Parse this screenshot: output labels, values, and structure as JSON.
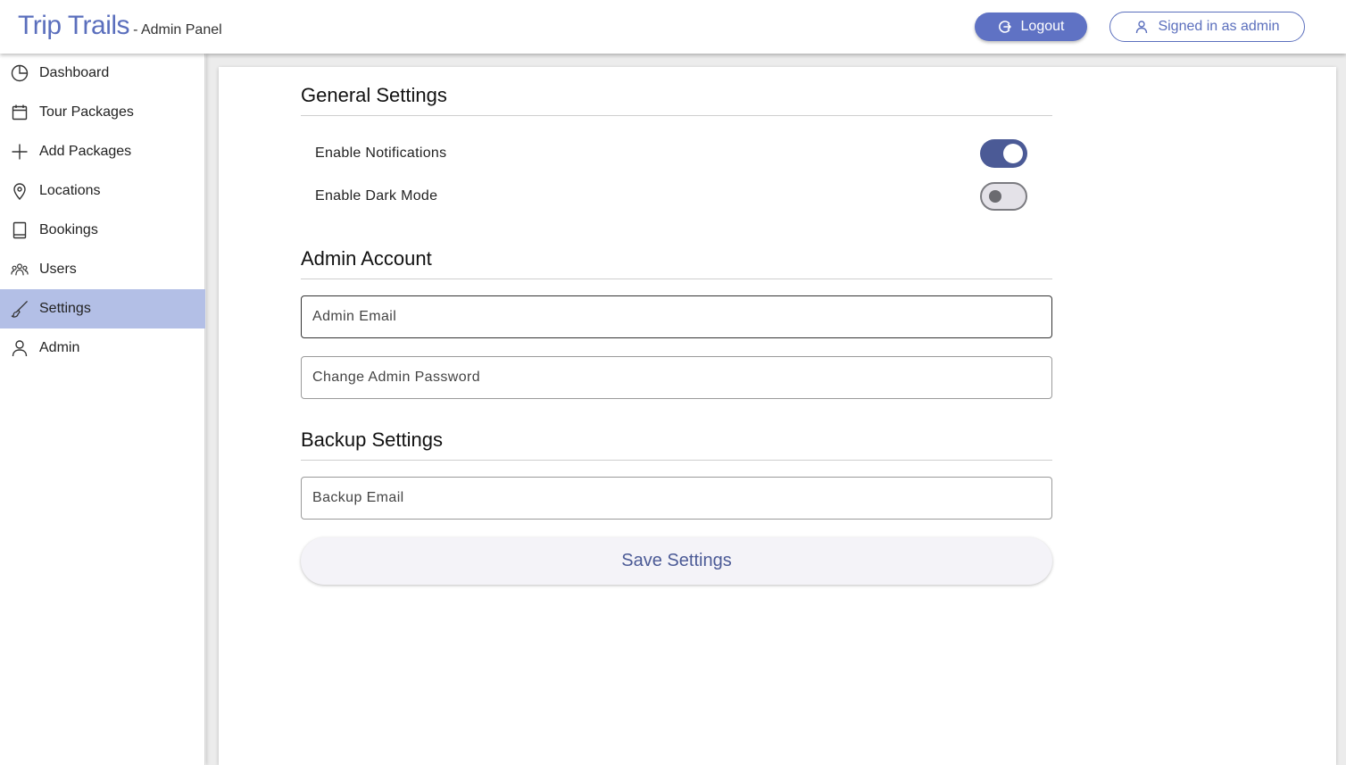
{
  "header": {
    "brand_name": "Trip Trails",
    "brand_sub": "- Admin Panel",
    "logout_label": "Logout",
    "signed_in_label": "Signed in as admin"
  },
  "sidebar": {
    "items": [
      {
        "label": "Dashboard",
        "icon": "pie-chart-icon"
      },
      {
        "label": "Tour Packages",
        "icon": "calendar-icon"
      },
      {
        "label": "Add Packages",
        "icon": "plus-icon"
      },
      {
        "label": "Locations",
        "icon": "map-pin-icon"
      },
      {
        "label": "Bookings",
        "icon": "book-icon"
      },
      {
        "label": "Users",
        "icon": "users-icon"
      },
      {
        "label": "Settings",
        "icon": "brush-icon",
        "active": true
      },
      {
        "label": "Admin",
        "icon": "user-icon"
      }
    ]
  },
  "settings": {
    "general_title": "General Settings",
    "notifications_label": "Enable Notifications",
    "notifications_on": true,
    "dark_mode_label": "Enable Dark Mode",
    "dark_mode_on": false,
    "admin_title": "Admin Account",
    "admin_email_placeholder": "Admin Email",
    "admin_password_placeholder": "Change Admin Password",
    "backup_title": "Backup Settings",
    "backup_email_placeholder": "Backup Email",
    "save_label": "Save Settings"
  },
  "colors": {
    "brand": "#5b6fbd",
    "active_nav": "#b3bfe6",
    "toggle_on": "#4b5a96"
  }
}
